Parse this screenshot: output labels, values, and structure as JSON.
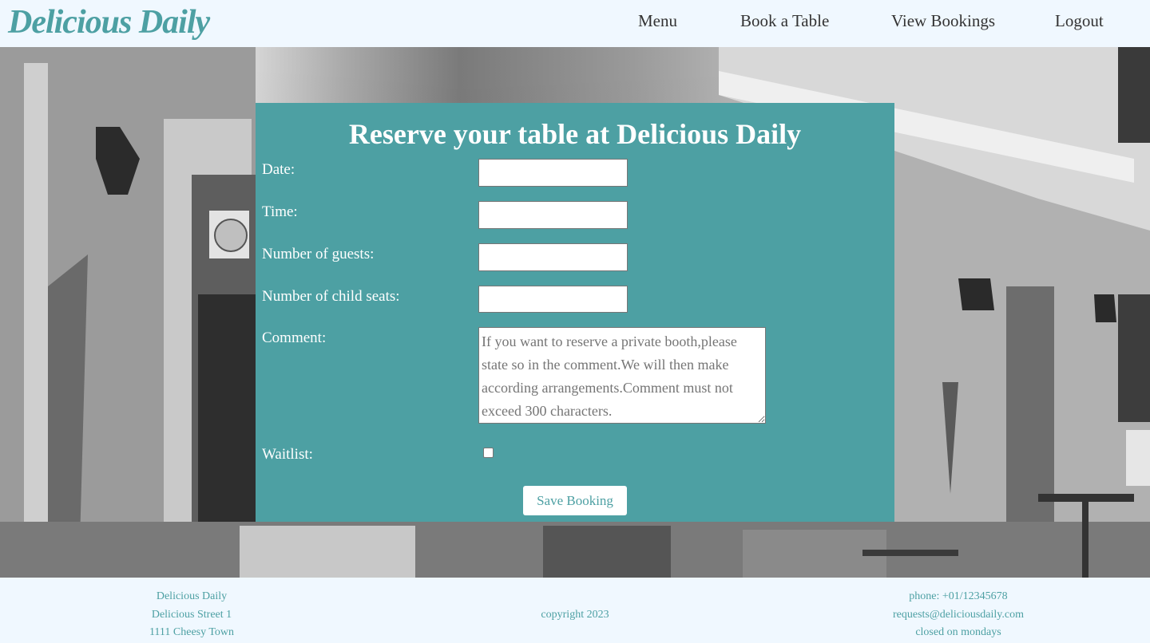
{
  "brand": {
    "logo": "Delicious Daily",
    "accent": "#4da0a3"
  },
  "nav": {
    "menu": "Menu",
    "book": "Book a Table",
    "view": "View Bookings",
    "logout": "Logout"
  },
  "form": {
    "title": "Reserve your table at Delicious Daily",
    "date_label": "Date:",
    "time_label": "Time:",
    "guests_label": "Number of guests:",
    "child_seats_label": "Number of child seats:",
    "comment_label": "Comment:",
    "comment_placeholder": "If you want to reserve a private booth,please state so in the comment.We will then make according arrangements.Comment must not exceed 300 characters.",
    "waitlist_label": "Waitlist:",
    "save_label": "Save Booking"
  },
  "footer": {
    "name": "Delicious Daily",
    "street": "Delicious Street 1",
    "town": "1111 Cheesy Town",
    "copyright": "copyright 2023",
    "phone": "phone: +01/12345678",
    "email": "requests@deliciousdaily.com",
    "hours": "closed on mondays"
  }
}
